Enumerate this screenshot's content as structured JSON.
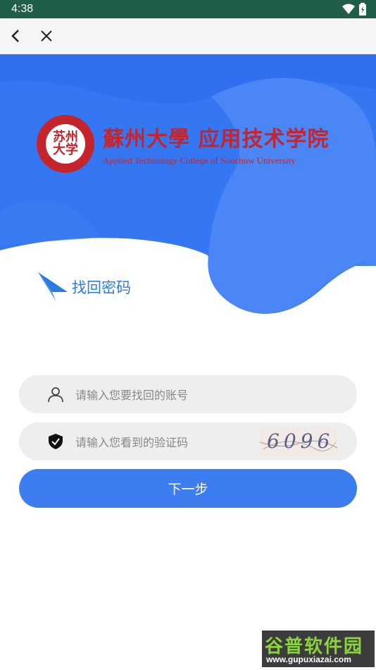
{
  "status_bar": {
    "time": "4:38"
  },
  "nav": {
    "back_icon": "chevron-left-icon",
    "close_icon": "close-icon"
  },
  "logo": {
    "seal_text": "苏州\n大学",
    "name_cn": "蘇州大學 应用技术学院",
    "name_en": "Applied Technology College of Soochow University"
  },
  "page": {
    "title": "找回密码"
  },
  "form": {
    "account_placeholder": "请输入您要找回的账号",
    "captcha_placeholder": "请输入您看到的验证码",
    "captcha_image_text": "6096",
    "next_label": "下一步"
  },
  "watermark": {
    "text": "谷普软件园",
    "url": "www.gupuxiazai.com"
  },
  "colors": {
    "primary": "#3c7ef0",
    "title_blue": "#2b7be4",
    "brand_red": "#c4242b",
    "status_bar": "#1f5f4a"
  }
}
